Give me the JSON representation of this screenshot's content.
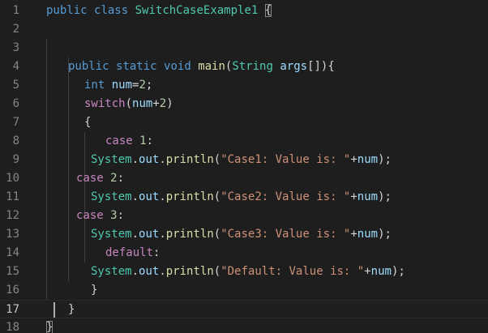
{
  "editor": {
    "colors": {
      "background": "#1e1e1e",
      "line_number": "#858585",
      "line_number_active": "#c6c6c6",
      "keyword": "#569cd6",
      "control": "#c586c0",
      "class": "#4ec9b0",
      "identifier": "#9cdcfe",
      "function": "#dcdcaa",
      "string": "#ce9178",
      "number": "#b5cea8",
      "punctuation": "#d4d4d4"
    },
    "active_line": 17,
    "lines": [
      {
        "n": "1",
        "tokens": [
          {
            "t": "public",
            "k": "keyword"
          },
          {
            "t": " ",
            "k": "plain"
          },
          {
            "t": "class",
            "k": "keyword"
          },
          {
            "t": " ",
            "k": "plain"
          },
          {
            "t": "SwitchCaseExample1",
            "k": "class"
          },
          {
            "t": " ",
            "k": "plain"
          },
          {
            "t": "{",
            "k": "bracket-match"
          }
        ]
      },
      {
        "n": "2",
        "tokens": []
      },
      {
        "n": "3",
        "tokens": []
      },
      {
        "n": "4",
        "tokens": [
          {
            "t": "public",
            "k": "keyword"
          },
          {
            "t": " ",
            "k": "plain"
          },
          {
            "t": "static",
            "k": "keyword"
          },
          {
            "t": " ",
            "k": "plain"
          },
          {
            "t": "void",
            "k": "keyword"
          },
          {
            "t": " ",
            "k": "plain"
          },
          {
            "t": "main",
            "k": "func"
          },
          {
            "t": "(",
            "k": "punct"
          },
          {
            "t": "String",
            "k": "class"
          },
          {
            "t": " ",
            "k": "plain"
          },
          {
            "t": "args",
            "k": "ident"
          },
          {
            "t": "[]){",
            "k": "punct"
          }
        ]
      },
      {
        "n": "5",
        "tokens": [
          {
            "t": "int",
            "k": "keyword"
          },
          {
            "t": " ",
            "k": "plain"
          },
          {
            "t": "num",
            "k": "ident"
          },
          {
            "t": "=",
            "k": "punct"
          },
          {
            "t": "2",
            "k": "number"
          },
          {
            "t": ";",
            "k": "punct"
          }
        ]
      },
      {
        "n": "6",
        "tokens": [
          {
            "t": "switch",
            "k": "control"
          },
          {
            "t": "(",
            "k": "punct"
          },
          {
            "t": "num",
            "k": "ident"
          },
          {
            "t": "+",
            "k": "punct"
          },
          {
            "t": "2",
            "k": "number"
          },
          {
            "t": ")",
            "k": "punct"
          }
        ]
      },
      {
        "n": "7",
        "tokens": [
          {
            "t": "{",
            "k": "punct"
          }
        ]
      },
      {
        "n": "8",
        "tokens": [
          {
            "t": "case",
            "k": "control"
          },
          {
            "t": " ",
            "k": "plain"
          },
          {
            "t": "1",
            "k": "number"
          },
          {
            "t": ":",
            "k": "punct"
          }
        ]
      },
      {
        "n": "9",
        "tokens": [
          {
            "t": "System",
            "k": "class"
          },
          {
            "t": ".",
            "k": "punct"
          },
          {
            "t": "out",
            "k": "ident"
          },
          {
            "t": ".",
            "k": "punct"
          },
          {
            "t": "println",
            "k": "func"
          },
          {
            "t": "(",
            "k": "punct"
          },
          {
            "t": "\"Case1: Value is: \"",
            "k": "string"
          },
          {
            "t": "+",
            "k": "punct"
          },
          {
            "t": "num",
            "k": "ident"
          },
          {
            "t": ");",
            "k": "punct"
          }
        ]
      },
      {
        "n": "10",
        "tokens": [
          {
            "t": "case",
            "k": "control"
          },
          {
            "t": " ",
            "k": "plain"
          },
          {
            "t": "2",
            "k": "number"
          },
          {
            "t": ":",
            "k": "punct"
          }
        ]
      },
      {
        "n": "11",
        "tokens": [
          {
            "t": "System",
            "k": "class"
          },
          {
            "t": ".",
            "k": "punct"
          },
          {
            "t": "out",
            "k": "ident"
          },
          {
            "t": ".",
            "k": "punct"
          },
          {
            "t": "println",
            "k": "func"
          },
          {
            "t": "(",
            "k": "punct"
          },
          {
            "t": "\"Case2: Value is: \"",
            "k": "string"
          },
          {
            "t": "+",
            "k": "punct"
          },
          {
            "t": "num",
            "k": "ident"
          },
          {
            "t": ");",
            "k": "punct"
          }
        ]
      },
      {
        "n": "12",
        "tokens": [
          {
            "t": "case",
            "k": "control"
          },
          {
            "t": " ",
            "k": "plain"
          },
          {
            "t": "3",
            "k": "number"
          },
          {
            "t": ":",
            "k": "punct"
          }
        ]
      },
      {
        "n": "13",
        "tokens": [
          {
            "t": "System",
            "k": "class"
          },
          {
            "t": ".",
            "k": "punct"
          },
          {
            "t": "out",
            "k": "ident"
          },
          {
            "t": ".",
            "k": "punct"
          },
          {
            "t": "println",
            "k": "func"
          },
          {
            "t": "(",
            "k": "punct"
          },
          {
            "t": "\"Case3: Value is: \"",
            "k": "string"
          },
          {
            "t": "+",
            "k": "punct"
          },
          {
            "t": "num",
            "k": "ident"
          },
          {
            "t": ");",
            "k": "punct"
          }
        ]
      },
      {
        "n": "14",
        "tokens": [
          {
            "t": "default",
            "k": "control"
          },
          {
            "t": ":",
            "k": "punct"
          }
        ]
      },
      {
        "n": "15",
        "tokens": [
          {
            "t": "System",
            "k": "class"
          },
          {
            "t": ".",
            "k": "punct"
          },
          {
            "t": "out",
            "k": "ident"
          },
          {
            "t": ".",
            "k": "punct"
          },
          {
            "t": "println",
            "k": "func"
          },
          {
            "t": "(",
            "k": "punct"
          },
          {
            "t": "\"Default: Value is: \"",
            "k": "string"
          },
          {
            "t": "+",
            "k": "punct"
          },
          {
            "t": "num",
            "k": "ident"
          },
          {
            "t": ");",
            "k": "punct"
          }
        ]
      },
      {
        "n": "16",
        "tokens": [
          {
            "t": "}",
            "k": "punct"
          }
        ]
      },
      {
        "n": "17",
        "tokens": [
          {
            "t": "}",
            "k": "punct"
          }
        ]
      },
      {
        "n": "18",
        "tokens": [
          {
            "t": "}",
            "k": "bracket-end"
          }
        ]
      }
    ]
  }
}
